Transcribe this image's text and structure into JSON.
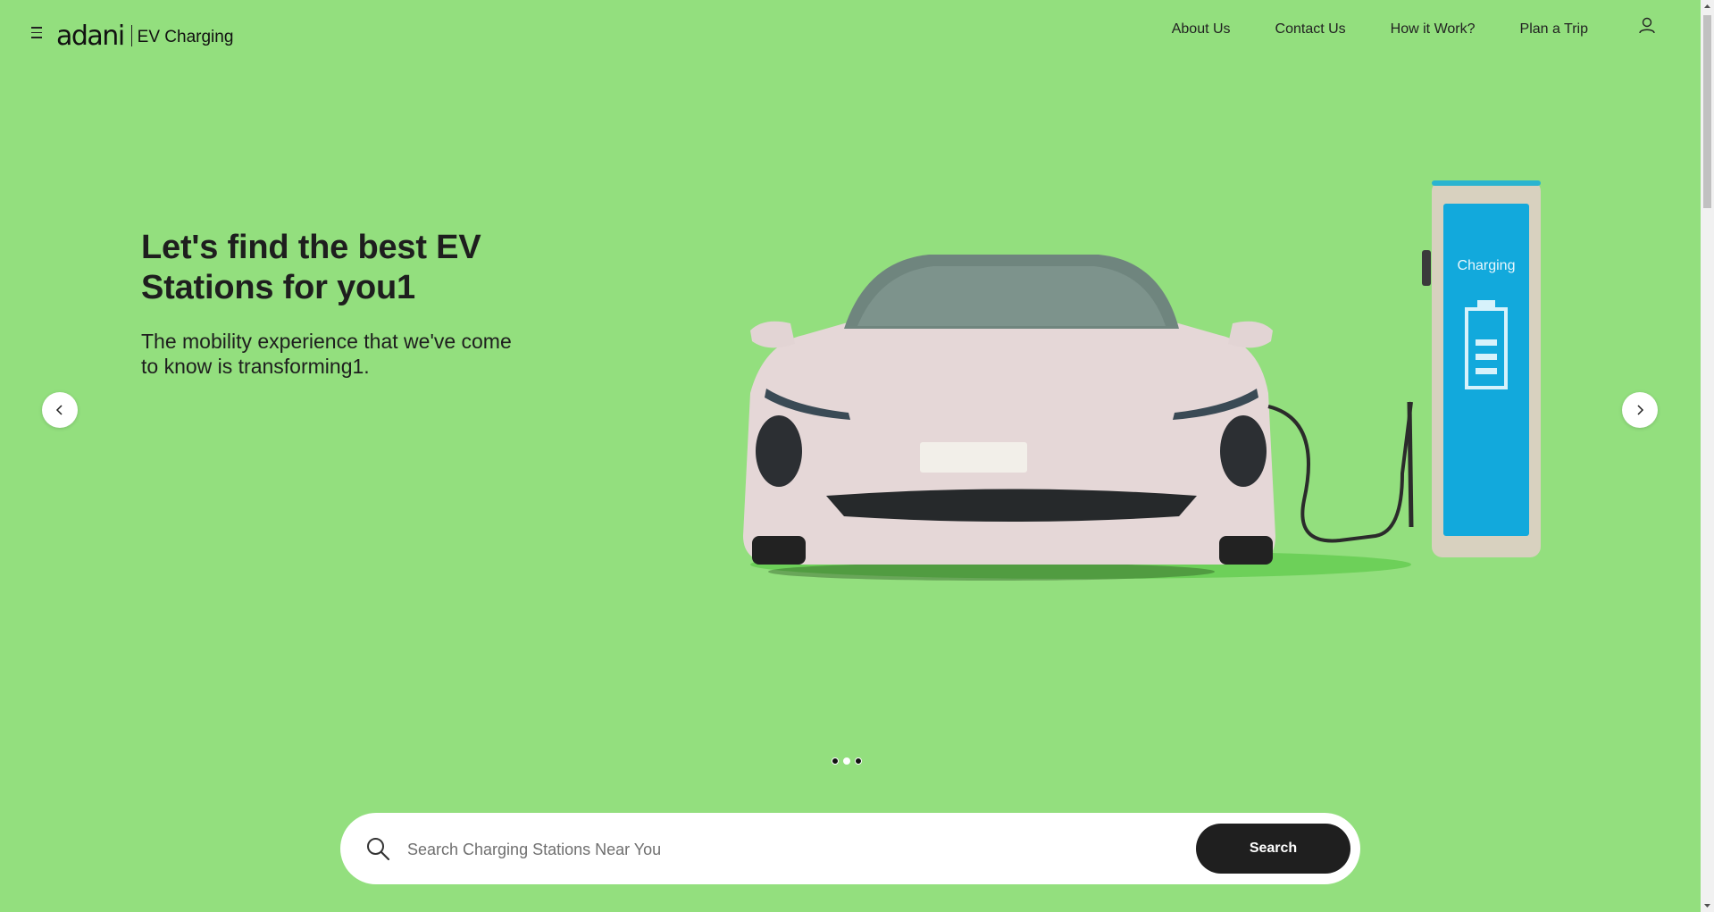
{
  "header": {
    "brand": "adani",
    "product": "EV Charging",
    "nav": [
      "About Us",
      "Contact Us",
      "How it Work?",
      "Plan a Trip"
    ]
  },
  "hero": {
    "title": "Let's find the best EV Stations for you1",
    "subtitle": "The mobility experience that we've come to know is transforming1.",
    "charger_screen_text": "Charging",
    "slides_total": 3,
    "active_slide": 2
  },
  "search": {
    "placeholder": "Search Charging Stations Near You",
    "button_label": "Search"
  },
  "colors": {
    "background": "#93df7e",
    "button": "#1f1f1f",
    "charger_screen": "#12a9dc"
  },
  "icons": [
    "menu-icon",
    "user-icon",
    "chevron-left-icon",
    "chevron-right-icon",
    "search-icon"
  ]
}
